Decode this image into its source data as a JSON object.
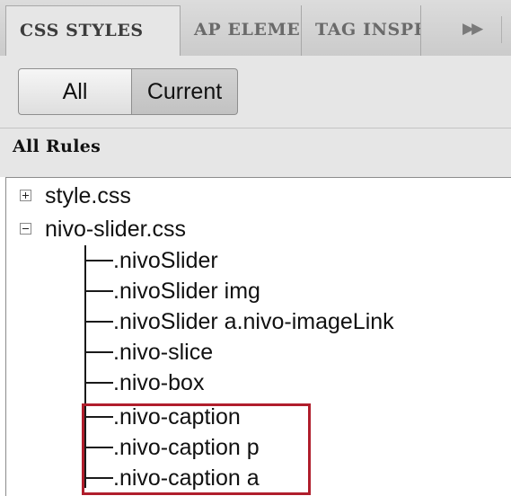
{
  "tabs": [
    {
      "label": "CSS STYLES",
      "active": true
    },
    {
      "label": "AP ELEMENTS",
      "active": false
    },
    {
      "label": "TAG INSPECTOR",
      "active": false
    }
  ],
  "tab_overflow_icon": "double-chevron-right-icon",
  "mode_buttons": {
    "all": "All",
    "current": "Current",
    "selected": "All"
  },
  "section_title": "All Rules",
  "tree": {
    "files": [
      {
        "name": "style.css",
        "expanded": false,
        "rules": []
      },
      {
        "name": "nivo-slider.css",
        "expanded": true,
        "rules": [
          ".nivoSlider",
          ".nivoSlider img",
          ".nivoSlider a.nivo-imageLink",
          ".nivo-slice",
          ".nivo-box",
          ".nivo-caption",
          ".nivo-caption p",
          ".nivo-caption a"
        ]
      }
    ]
  },
  "highlight_color": "#b01e2c"
}
